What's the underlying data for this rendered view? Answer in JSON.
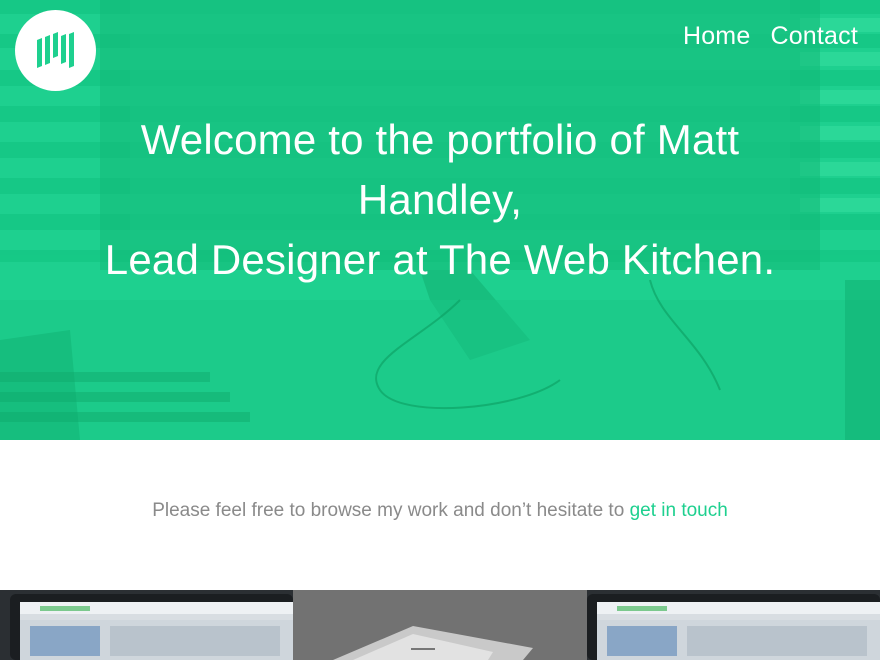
{
  "nav": {
    "items": [
      {
        "label": "Home"
      },
      {
        "label": "Contact"
      }
    ]
  },
  "hero": {
    "headline_line1": "Welcome to the portfolio of Matt",
    "headline_line2": "Handley,",
    "headline_line3": "Lead Designer at The Web Kitchen."
  },
  "intro": {
    "text": "Please feel free to browse my work and don’t hesitate to ",
    "link_label": "get in touch"
  },
  "colors": {
    "accent": "#1ed08f",
    "hero_bg": "#1ed08f",
    "body_text": "#8a8a8a"
  },
  "icons": {
    "logo": "mh-monogram-logo"
  }
}
